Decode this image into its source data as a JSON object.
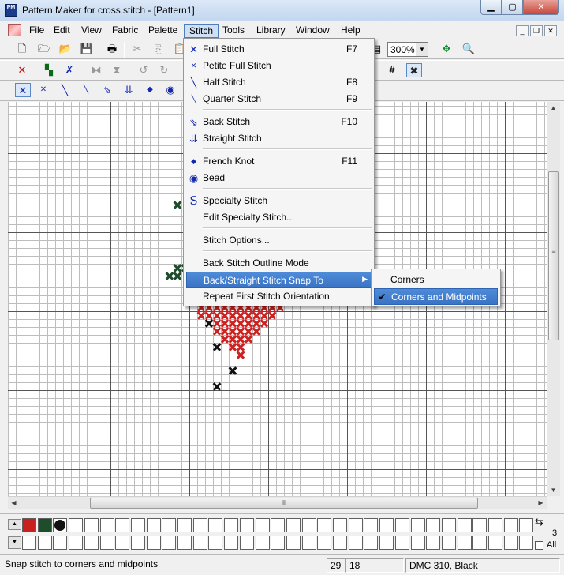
{
  "window": {
    "title": "Pattern Maker for cross stitch - [Pattern1]",
    "app_icon_text": "PM"
  },
  "menubar": [
    "File",
    "Edit",
    "View",
    "Fabric",
    "Palette",
    "Stitch",
    "Tools",
    "Library",
    "Window",
    "Help"
  ],
  "toolbar": {
    "zoom": "300%"
  },
  "stitch_menu": {
    "items": [
      {
        "label": "Full Stitch",
        "shortcut": "F7",
        "icon": "full-stitch-icon"
      },
      {
        "label": "Petite Full Stitch",
        "shortcut": "",
        "icon": "petite-full-stitch-icon"
      },
      {
        "label": "Half Stitch",
        "shortcut": "F8",
        "icon": "half-stitch-icon"
      },
      {
        "label": "Quarter Stitch",
        "shortcut": "F9",
        "icon": "quarter-stitch-icon"
      },
      {
        "label": "Back Stitch",
        "shortcut": "F10",
        "icon": "back-stitch-icon"
      },
      {
        "label": "Straight Stitch",
        "shortcut": "",
        "icon": "straight-stitch-icon"
      },
      {
        "label": "French Knot",
        "shortcut": "F11",
        "icon": "french-knot-icon"
      },
      {
        "label": "Bead",
        "shortcut": "",
        "icon": "bead-icon"
      },
      {
        "label": "Specialty Stitch",
        "shortcut": "",
        "icon": "specialty-stitch-icon"
      },
      {
        "label": "Edit Specialty Stitch...",
        "shortcut": ""
      },
      {
        "label": "Stitch Options...",
        "shortcut": ""
      },
      {
        "label": "Back Stitch Outline Mode",
        "shortcut": ""
      },
      {
        "label": "Back/Straight Stitch Snap To",
        "shortcut": ""
      },
      {
        "label": "Repeat First Stitch Orientation",
        "shortcut": ""
      }
    ],
    "submenu": [
      {
        "label": "Corners",
        "checked": false
      },
      {
        "label": "Corners and Midpoints",
        "checked": true
      }
    ]
  },
  "palette": {
    "swatches": [
      "#c8201e",
      "#1e4d2b",
      "#111111"
    ],
    "count_label": "3",
    "all_label": "All"
  },
  "status": {
    "message": "Snap stitch to corners and midpoints",
    "col": "29",
    "row": "18",
    "thread": "DMC  310, Black"
  },
  "colors": {
    "red_stitch": "#cc2222",
    "green_stitch": "#1e4d2b",
    "black_stitch": "#111111",
    "highlight": "#3a73c4"
  }
}
